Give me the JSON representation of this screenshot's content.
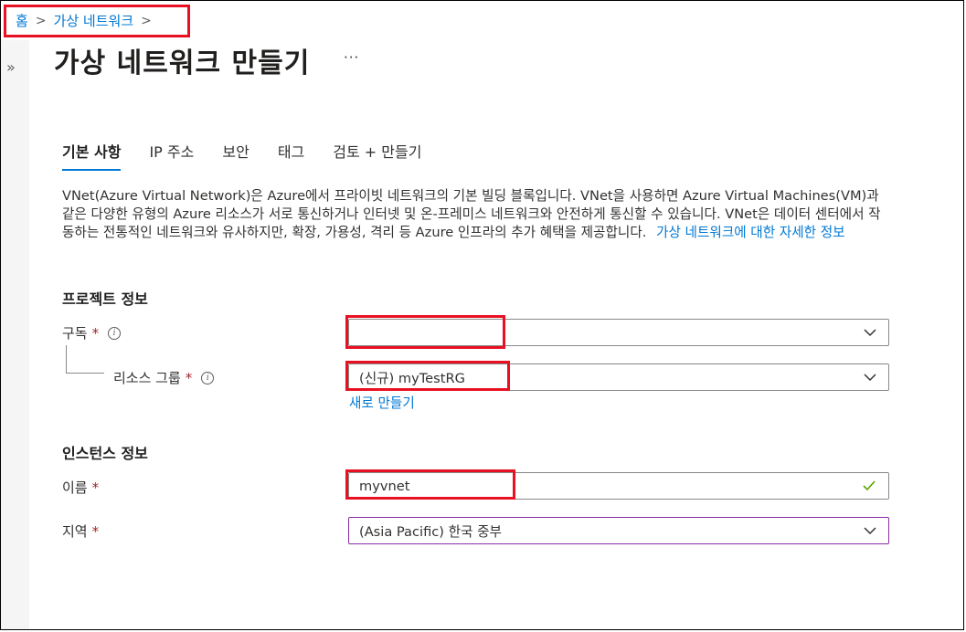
{
  "breadcrumb": {
    "home": "홈",
    "current": "가상 네트워크"
  },
  "page": {
    "title": "가상 네트워크 만들기",
    "more": "···"
  },
  "tabs": [
    "기본 사항",
    "IP 주소",
    "보안",
    "태그",
    "검토 + 만들기"
  ],
  "description": {
    "text": "VNet(Azure Virtual Network)은 Azure에서 프라이빗 네트워크의 기본 빌딩 블록입니다. VNet을 사용하면 Azure Virtual Machines(VM)과 같은 다양한 유형의 Azure 리소스가 서로 통신하거나 인터넷 및 온-프레미스 네트워크와 안전하게 통신할 수 있습니다. VNet은 데이터 센터에서 작동하는 전통적인 네트워크와 유사하지만, 확장, 가용성, 격리 등 Azure 인프라의 추가 혜택을 제공합니다.",
    "link": "가상 네트워크에 대한 자세한 정보"
  },
  "project": {
    "title": "프로젝트 정보",
    "subscription": {
      "label": "구독",
      "required": "*",
      "value": ""
    },
    "resource_group": {
      "label": "리소스 그룹",
      "required": "*",
      "value": "(신규) myTestRG",
      "create_new": "새로 만들기"
    }
  },
  "instance": {
    "title": "인스턴스 정보",
    "name": {
      "label": "이름",
      "required": "*",
      "value": "myvnet"
    },
    "region": {
      "label": "지역",
      "required": "*",
      "value": "(Asia Pacific) 한국 중부"
    }
  },
  "colors": {
    "accent": "#0078d4",
    "highlight": "#e81123",
    "valid": "#57a300",
    "required": "#a4262c"
  },
  "icons": {
    "expand": "double-chevron-right-icon",
    "info": "info-icon",
    "dropdown": "chevron-down-icon",
    "valid": "check-icon"
  }
}
